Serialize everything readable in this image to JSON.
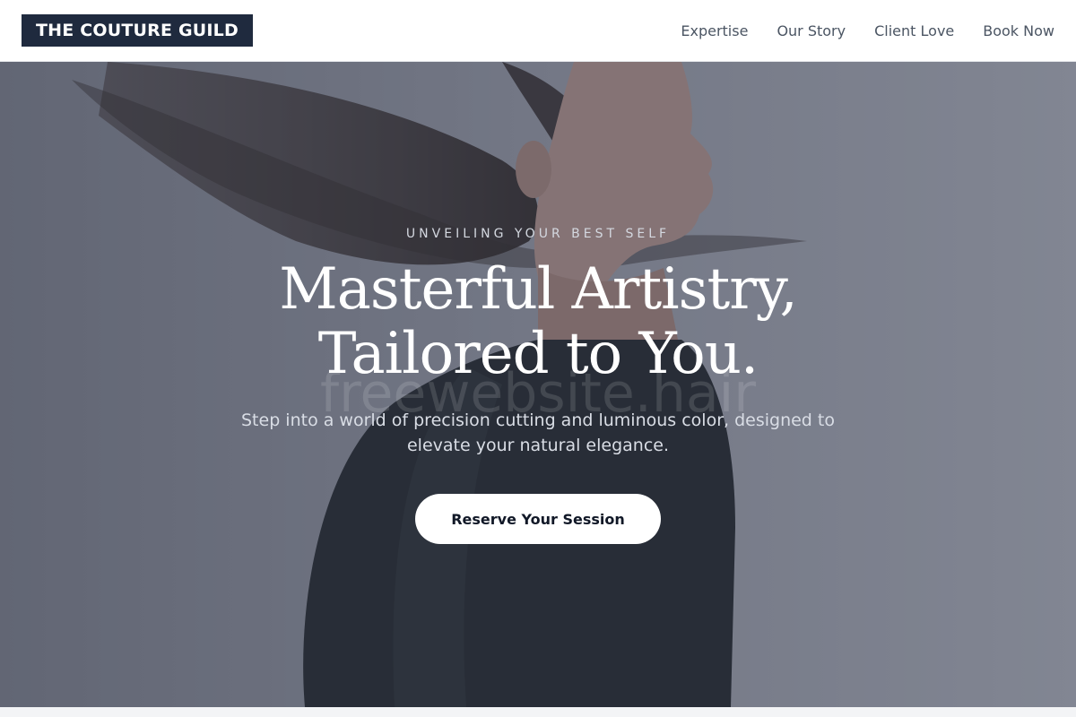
{
  "brand": {
    "name": "THE COUTURE GUILD"
  },
  "nav": {
    "links": [
      "Expertise",
      "Our Story",
      "Client Love",
      "Book Now"
    ]
  },
  "hero": {
    "eyebrow": "UNVEILING YOUR BEST SELF",
    "headline": "Masterful Artistry, Tailored to You.",
    "subtitle": "Step into a world of precision cutting and luminous color, designed to elevate your natural elegance.",
    "cta_label": "Reserve Your Session",
    "watermark": "freewebsite.hair",
    "image": "woman-flipping-hair-photo"
  },
  "colors": {
    "brand_bg": "#1f2a3e",
    "nav_text": "#4b5563",
    "overlay": "#3a4054",
    "cta_bg": "#ffffff",
    "cta_text": "#111827"
  }
}
